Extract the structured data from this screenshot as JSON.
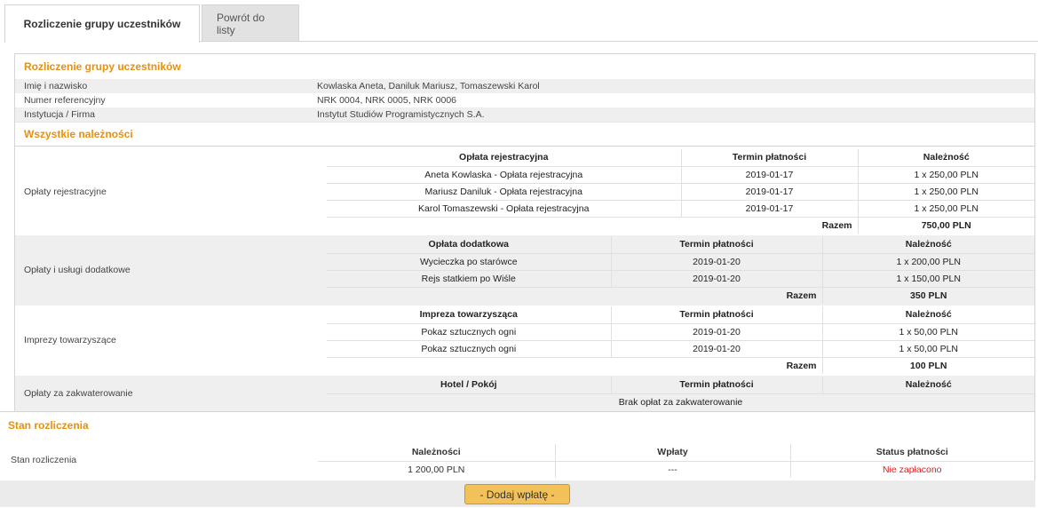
{
  "tabs": [
    {
      "label": "Rozliczenie grupy uczestników",
      "active": true
    },
    {
      "label": "Powrót do listy",
      "active": false
    }
  ],
  "group_info": {
    "title": "Rozliczenie grupy uczestników",
    "rows": [
      {
        "label": "Imię i nazwisko",
        "value": "Kowlaska Aneta, Daniluk Mariusz, Tomaszewski Karol"
      },
      {
        "label": "Numer referencyjny",
        "value": "NRK 0004, NRK 0005, NRK 0006"
      },
      {
        "label": "Instytucja / Firma",
        "value": "Instytut Studiów Programistycznych S.A."
      }
    ]
  },
  "fees": {
    "title": "Wszystkie należności",
    "registration": {
      "label": "Opłaty rejestracyjne",
      "headers": [
        "Opłata rejestracyjna",
        "Termin płatności",
        "Należność"
      ],
      "rows": [
        [
          "Aneta Kowlaska - Opłata rejestracyjna",
          "2019-01-17",
          "1 x 250,00 PLN"
        ],
        [
          "Mariusz Daniluk - Opłata rejestracyjna",
          "2019-01-17",
          "1 x 250,00 PLN"
        ],
        [
          "Karol Tomaszewski - Opłata rejestracyjna",
          "2019-01-17",
          "1 x 250,00 PLN"
        ]
      ],
      "sum_label": "Razem",
      "sum_value": "750,00 PLN"
    },
    "extras": {
      "label": "Opłaty i usługi dodatkowe",
      "headers": [
        "Opłata dodatkowa",
        "Termin płatności",
        "Należność"
      ],
      "rows": [
        [
          "Wycieczka po starówce",
          "2019-01-20",
          "1 x 200,00 PLN"
        ],
        [
          "Rejs statkiem po Wiśle",
          "2019-01-20",
          "1 x 150,00 PLN"
        ]
      ],
      "sum_label": "Razem",
      "sum_value": "350 PLN"
    },
    "events": {
      "label": "Imprezy towarzyszące",
      "headers": [
        "Impreza towarzysząca",
        "Termin płatności",
        "Należność"
      ],
      "rows": [
        [
          "Pokaz sztucznych ogni",
          "2019-01-20",
          "1 x 50,00 PLN"
        ],
        [
          "Pokaz sztucznych ogni",
          "2019-01-20",
          "1 x 50,00 PLN"
        ]
      ],
      "sum_label": "Razem",
      "sum_value": "100 PLN"
    },
    "accommodation": {
      "label": "Opłaty za zakwaterowanie",
      "headers": [
        "Hotel / Pokój",
        "Termin płatności",
        "Należność"
      ],
      "empty_text": "Brak opłat za zakwaterowanie"
    }
  },
  "settlement": {
    "title": "Stan rozliczenia",
    "label": "Stan rozliczenia",
    "headers": [
      "Należności",
      "Wpłaty",
      "Status płatności"
    ],
    "due": "1 200,00 PLN",
    "paid": "---",
    "status": "Nie zapłacono",
    "status_color": "#e31b1b",
    "add_payment_label": "- Dodaj wpłatę -"
  },
  "colors": {
    "accent": "#e8900a",
    "button": "#f3c15a"
  }
}
